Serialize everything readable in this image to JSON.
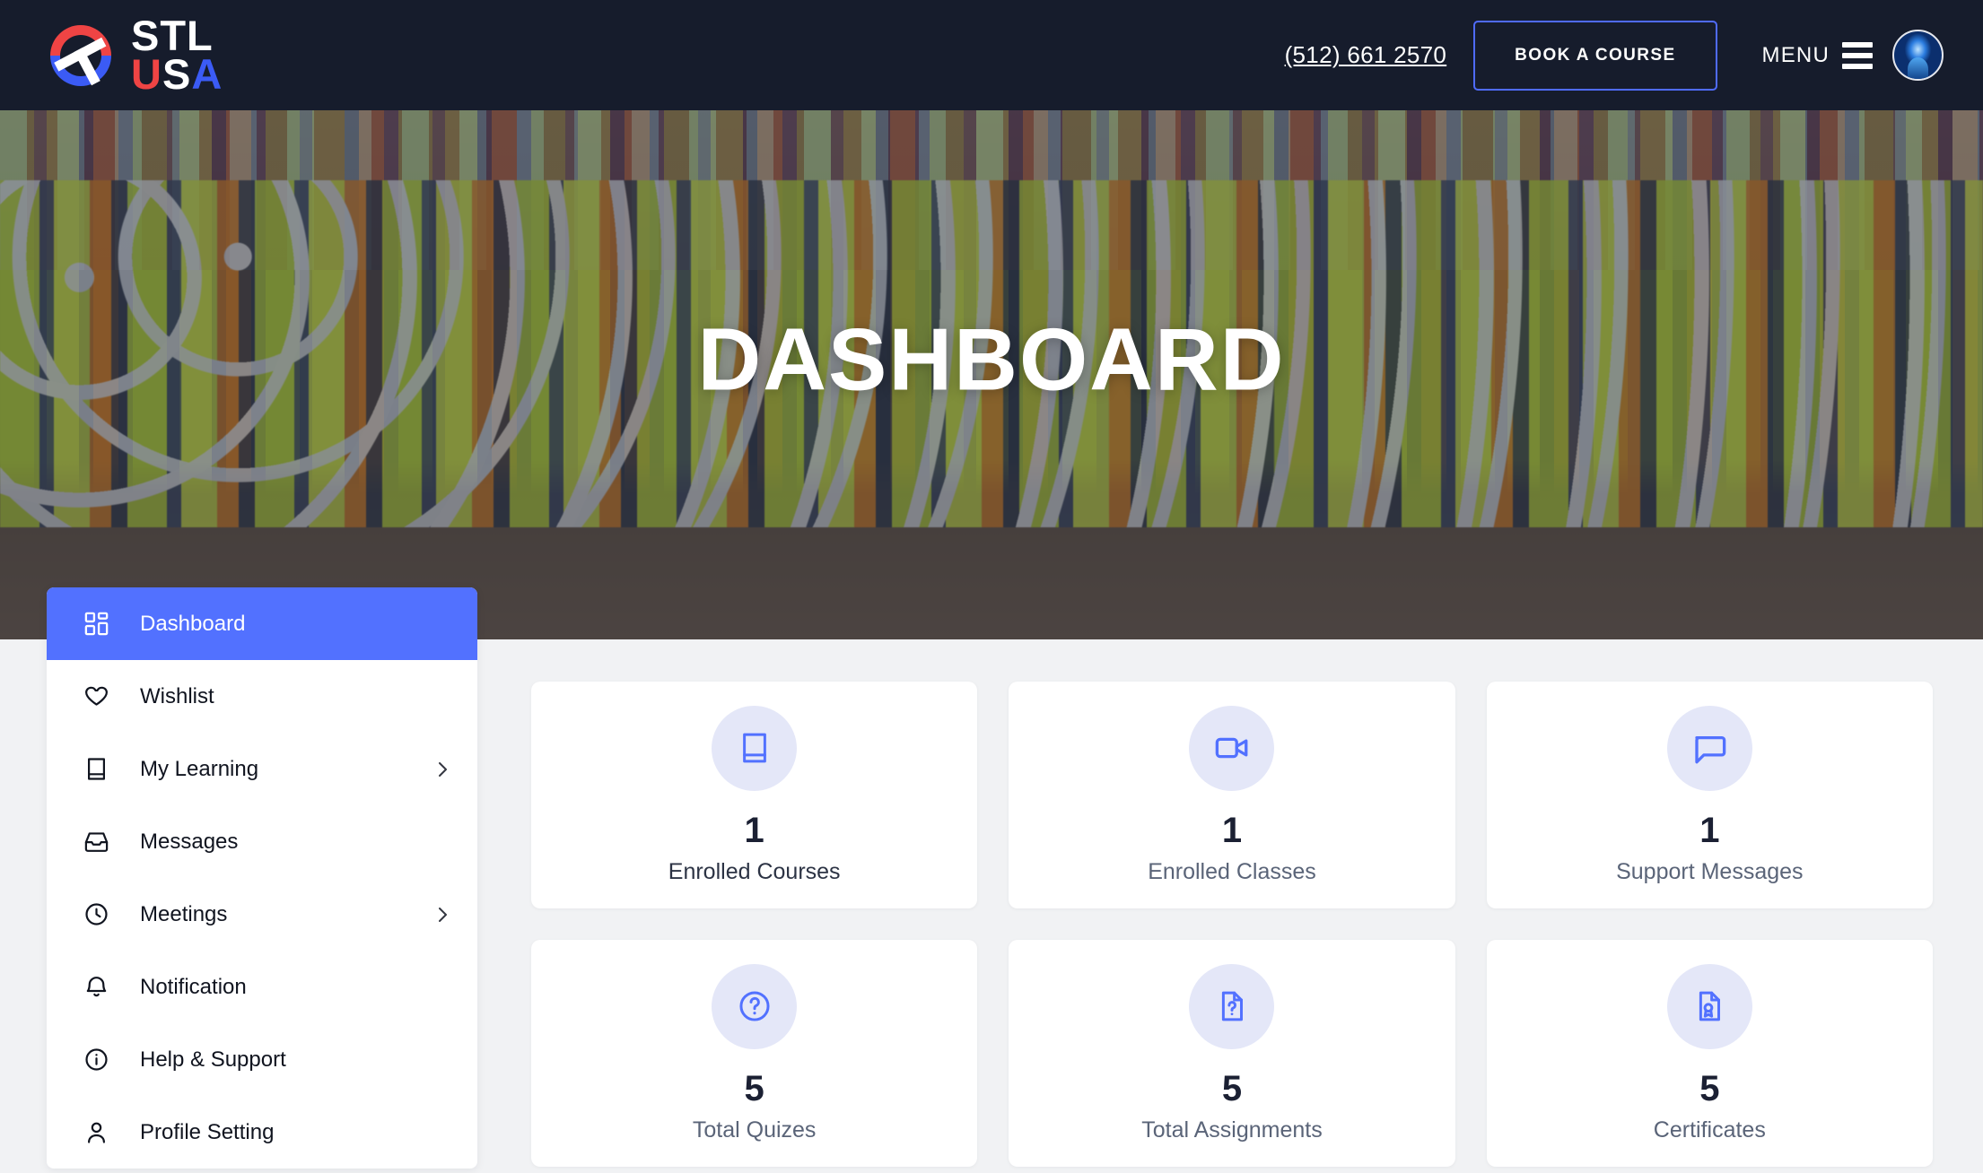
{
  "header": {
    "logo": {
      "line1": "STL",
      "line2_u": "U",
      "line2_s": "S",
      "line2_a": "A",
      "colors": {
        "red": "#ef4444",
        "blue": "#3b5bf5",
        "white": "#ffffff"
      }
    },
    "phone": "(512) 661 2570",
    "book_button": "BOOK A COURSE",
    "menu_label": "MENU",
    "avatar_name": "user-avatar",
    "background": "#161c2c",
    "accent": "#4f6bff"
  },
  "hero": {
    "title": "DASHBOARD",
    "image_alt": "group-photo-of-construction-workers-in-hi-vis-vests-and-hard-hats",
    "overlay_color": "#161c2c"
  },
  "sidebar": {
    "active_color": "#5271ff",
    "items": [
      {
        "label": "Dashboard",
        "icon": "grid-icon",
        "active": true,
        "chevron": false
      },
      {
        "label": "Wishlist",
        "icon": "heart-icon",
        "active": false,
        "chevron": false
      },
      {
        "label": "My Learning",
        "icon": "book-icon",
        "active": false,
        "chevron": true
      },
      {
        "label": "Messages",
        "icon": "inbox-icon",
        "active": false,
        "chevron": false
      },
      {
        "label": "Meetings",
        "icon": "clock-icon",
        "active": false,
        "chevron": true
      },
      {
        "label": "Notification",
        "icon": "bell-icon",
        "active": false,
        "chevron": false
      },
      {
        "label": "Help & Support",
        "icon": "info-icon",
        "active": false,
        "chevron": false
      },
      {
        "label": "Profile Setting",
        "icon": "user-icon",
        "active": false,
        "chevron": false
      }
    ]
  },
  "stats": {
    "icon_bg": "#e4e7f8",
    "icon_color": "#5271ff",
    "cards": [
      {
        "value": "1",
        "label": "Enrolled Courses",
        "icon": "book-icon",
        "label_dark": true
      },
      {
        "value": "1",
        "label": "Enrolled Classes",
        "icon": "video-icon",
        "label_dark": false
      },
      {
        "value": "1",
        "label": "Support Messages",
        "icon": "chat-icon",
        "label_dark": false
      },
      {
        "value": "5",
        "label": "Total Quizes",
        "icon": "question-icon",
        "label_dark": false
      },
      {
        "value": "5",
        "label": "Total Assignments",
        "icon": "file-question-icon",
        "label_dark": false
      },
      {
        "value": "5",
        "label": "Certificates",
        "icon": "certificate-icon",
        "label_dark": false
      }
    ]
  }
}
